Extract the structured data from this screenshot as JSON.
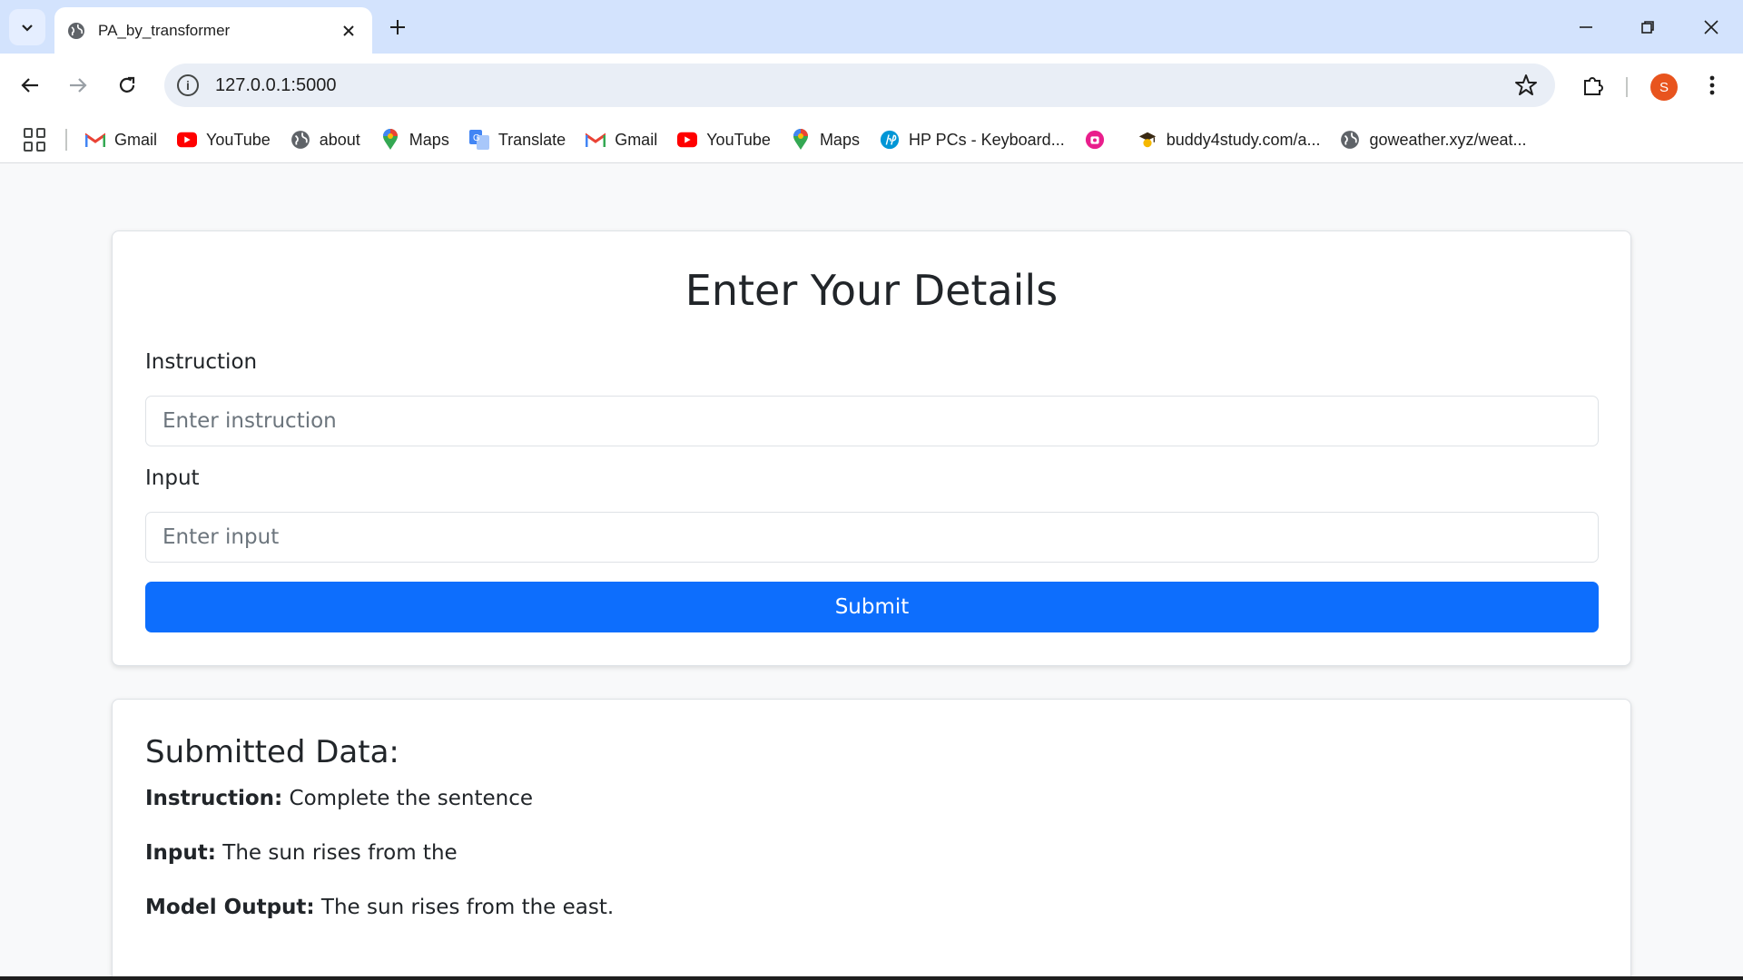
{
  "browser": {
    "tab_title": "PA_by_transformer",
    "url": "127.0.0.1:5000",
    "profile_initial": "S",
    "profile_color": "#e8541e",
    "bookmarks": [
      {
        "label": "Gmail",
        "icon": "gmail-icon"
      },
      {
        "label": "YouTube",
        "icon": "youtube-icon"
      },
      {
        "label": "about",
        "icon": "globe-icon"
      },
      {
        "label": "Maps",
        "icon": "maps-icon"
      },
      {
        "label": "Translate",
        "icon": "translate-icon"
      },
      {
        "label": "Gmail",
        "icon": "gmail-icon"
      },
      {
        "label": "YouTube",
        "icon": "youtube-icon"
      },
      {
        "label": "Maps",
        "icon": "maps-icon"
      },
      {
        "label": "HP PCs - Keyboard...",
        "icon": "hp-icon"
      },
      {
        "label": "",
        "icon": "app-icon"
      },
      {
        "label": "buddy4study.com/a...",
        "icon": "graduation-cap-icon"
      },
      {
        "label": "goweather.xyz/weat...",
        "icon": "globe-icon"
      }
    ]
  },
  "form": {
    "title": "Enter Your Details",
    "instruction_label": "Instruction",
    "instruction_placeholder": "Enter instruction",
    "input_label": "Input",
    "input_placeholder": "Enter input",
    "submit_label": "Submit",
    "submit_color": "#0d6efd"
  },
  "result": {
    "title": "Submitted Data:",
    "instruction_label": "Instruction:",
    "instruction_value": "Complete the sentence",
    "input_label": "Input:",
    "input_value": "The sun rises from the",
    "output_label": "Model Output:",
    "output_value": "The sun rises from the east."
  }
}
